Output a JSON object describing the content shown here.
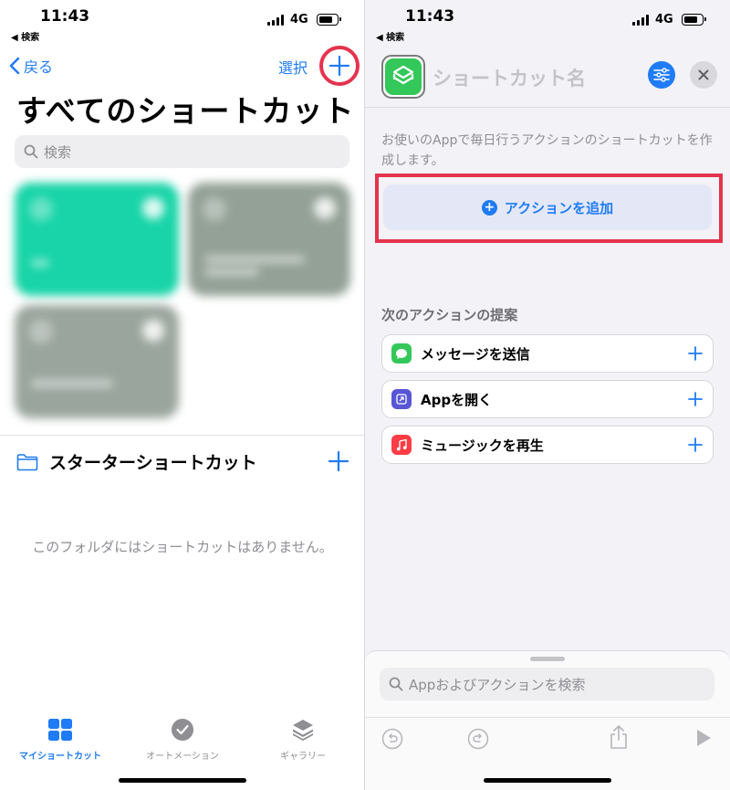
{
  "colors": {
    "accent": "#1f7bf6",
    "highlight": "#e5334d",
    "shortcuts_green": "#34c759"
  },
  "left": {
    "status": {
      "time": "11:43",
      "back": "◀ 検索",
      "network": "4G"
    },
    "nav": {
      "back_label": "戻る",
      "select_label": "選択",
      "add_icon": "plus-icon"
    },
    "title": "すべてのショートカット",
    "search_placeholder": "検索",
    "folder": {
      "label": "スターターショートカット",
      "icon": "folder-icon"
    },
    "empty_message": "このフォルダにはショートカットはありません。",
    "tabs": [
      {
        "label": "マイショートカット",
        "icon": "grid-icon"
      },
      {
        "label": "オートメーション",
        "icon": "clock-check-icon"
      },
      {
        "label": "ギャラリー",
        "icon": "layers-icon"
      }
    ]
  },
  "right": {
    "status": {
      "time": "11:43",
      "back": "◀ 検索",
      "network": "4G"
    },
    "name_placeholder": "ショートカット名",
    "description": "お使いのAppで毎日行うアクションのショートカットを作成します。",
    "add_action_label": "アクションを追加",
    "suggestions_title": "次のアクションの提案",
    "suggestions": [
      {
        "label": "メッセージを送信",
        "icon": "messages-icon",
        "color": "#34c759"
      },
      {
        "label": "Appを開く",
        "icon": "open-app-icon",
        "color": "#5856d6"
      },
      {
        "label": "ミュージックを再生",
        "icon": "music-icon",
        "color": "#fc3c44"
      }
    ],
    "search_placeholder": "Appおよびアクションを検索"
  }
}
